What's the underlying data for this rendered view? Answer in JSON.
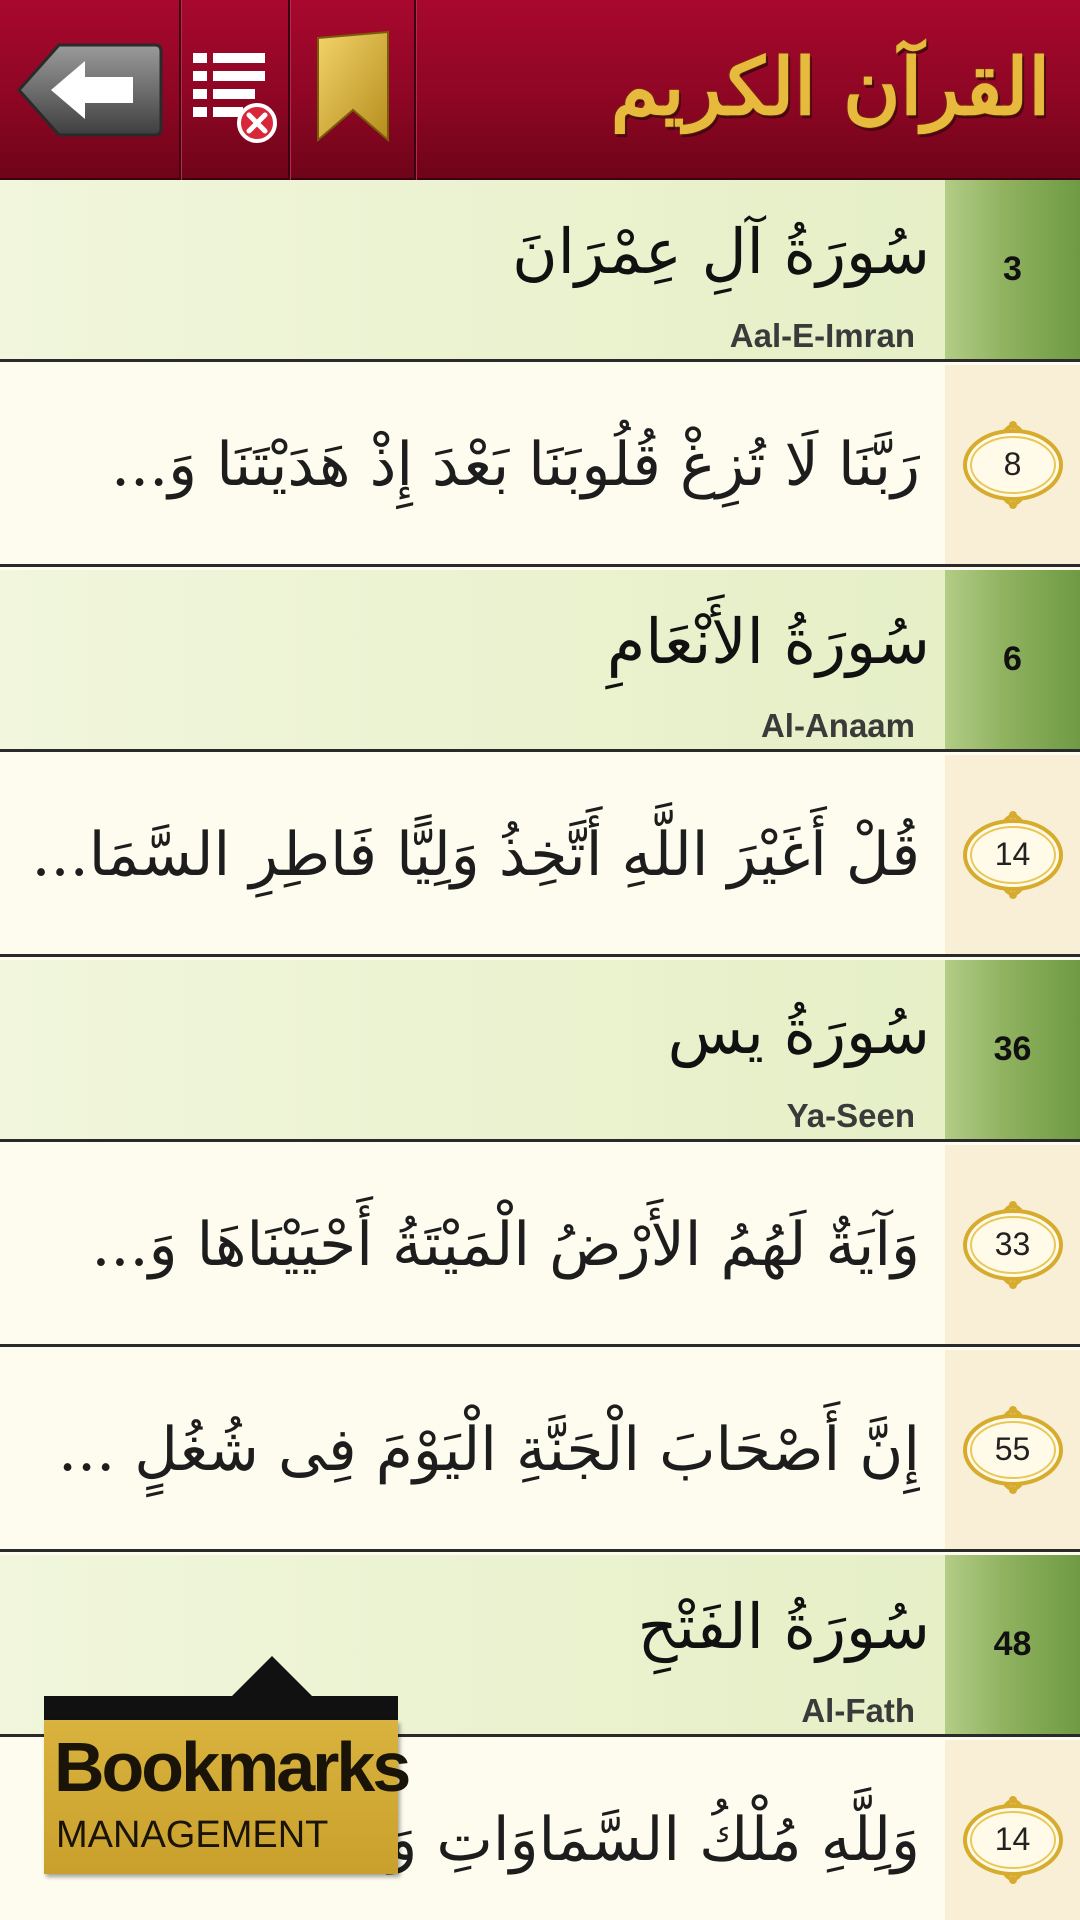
{
  "header": {
    "app_title": "القرآن الكريم",
    "buttons": {
      "back": "back-arrow-icon",
      "clear": "list-clear-icon",
      "bookmark": "bookmark-icon"
    }
  },
  "colors": {
    "header_red": "#9a0729",
    "logo_gold": "#e7b93c",
    "surah_green": "#8fb25f",
    "tooltip_gold": "#d1a935"
  },
  "bookmarks": [
    {
      "type": "surah",
      "number": "3",
      "title": "سُورَةُ آلِ عِمْرَانَ",
      "name": "Aal-E-Imran"
    },
    {
      "type": "verse",
      "ayah": "8",
      "text": "رَبَّنَا لَا تُزِغْ قُلُوبَنَا بَعْدَ إِذْ هَدَيْتَنَا وَ..."
    },
    {
      "type": "surah",
      "number": "6",
      "title": "سُورَةُ الأَنْعَامِ",
      "name": "Al-Anaam"
    },
    {
      "type": "verse",
      "ayah": "14",
      "text": "قُلْ أَغَيْرَ اللَّهِ أَتَّخِذُ وَلِيًّا فَاطِرِ السَّمَا..."
    },
    {
      "type": "surah",
      "number": "36",
      "title": "سُورَةُ يس",
      "name": "Ya-Seen"
    },
    {
      "type": "verse",
      "ayah": "33",
      "text": "وَآيَةٌ لَهُمُ الأَرْضُ الْمَيْتَةُ أَحْيَيْنَاهَا وَ..."
    },
    {
      "type": "verse",
      "ayah": "55",
      "text": "إِنَّ أَصْحَابَ الْجَنَّةِ الْيَوْمَ فِى شُغُلٍ ..."
    },
    {
      "type": "surah",
      "number": "48",
      "title": "سُورَةُ الفَتْحِ",
      "name": "Al-Fath"
    },
    {
      "type": "verse",
      "ayah": "14",
      "text": "وَلِلَّهِ مُلْكُ السَّمَاوَاتِ وَ"
    }
  ],
  "tooltip": {
    "title": "Bookmarks",
    "subtitle": "MANAGEMENT"
  }
}
